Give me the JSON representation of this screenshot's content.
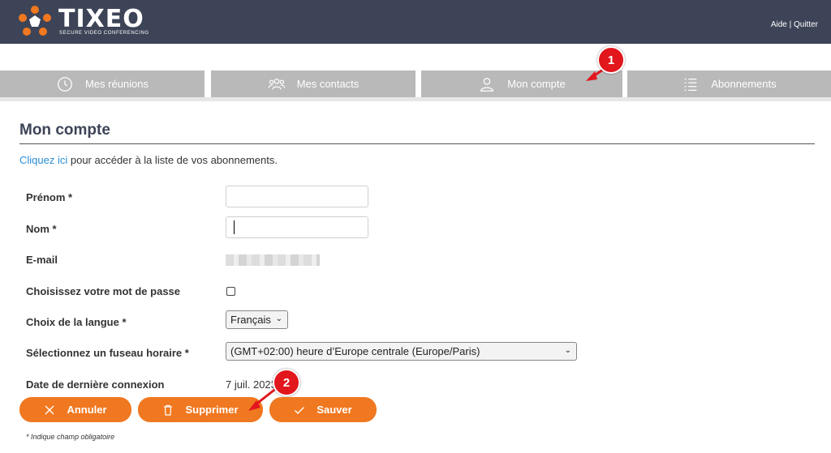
{
  "header": {
    "logo_text": "TIXEO",
    "logo_subtitle": "SECURE VIDEO CONFERENCING",
    "help_link": "Aide",
    "separator": " | ",
    "quit_link": "Quitter",
    "background_color": "#3d4457"
  },
  "tabs": [
    {
      "label": "Mes réunions",
      "icon": "clock-icon"
    },
    {
      "label": "Mes contacts",
      "icon": "contacts-icon"
    },
    {
      "label": "Mon compte",
      "icon": "user-icon"
    },
    {
      "label": "Abonnements",
      "icon": "list-icon"
    }
  ],
  "markers": {
    "one": "1",
    "two": "2"
  },
  "page": {
    "title": "Mon compte",
    "info_link": "Cliquez ici",
    "info_text": " pour accéder à la liste de vos abonnements."
  },
  "form": {
    "first_name_label": "Prénom *",
    "first_name_value": "",
    "last_name_label": "Nom *",
    "last_name_value": "",
    "email_label": "E-mail",
    "password_label": "Choisissez votre mot de passe",
    "password_checked": false,
    "language_label": "Choix de la langue *",
    "language_value": "Français",
    "timezone_label": "Sélectionnez un fuseau horaire *",
    "timezone_value": "(GMT+02:00) heure d’Europe centrale (Europe/Paris)",
    "last_login_label": "Date de dernière connexion",
    "last_login_value": "7 juil. 2023"
  },
  "buttons": {
    "cancel": "Annuler",
    "delete": "Supprimer",
    "save": "Sauver"
  },
  "footnote": "* Indique champ obligatoire",
  "colors": {
    "accent": "#f07820",
    "tab": "#b9b9b9",
    "link": "#2b8ed6",
    "marker": "#e2161d"
  }
}
